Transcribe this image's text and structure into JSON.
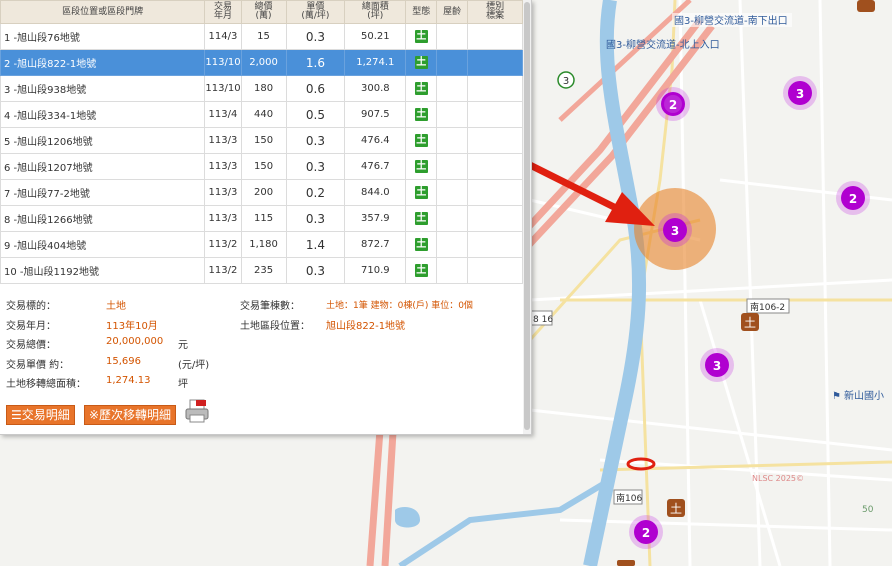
{
  "table": {
    "headers": {
      "address": "區段位置或區段門牌",
      "date": "交易\n年月",
      "total": "總價\n(萬)",
      "unit": "單價\n(萬/坪)",
      "area": "總面積\n(坪)",
      "type": "型態",
      "age": "屋齡",
      "special": "標別\n標案"
    },
    "rows": [
      {
        "address": "1 -旭山段76地號",
        "date": "114/3",
        "total": "15",
        "unit": "0.3",
        "area": "50.21",
        "type": "土"
      },
      {
        "address": "2 -旭山段822-1地號",
        "date": "113/10",
        "total": "2,000",
        "unit": "1.6",
        "area": "1,274.1",
        "type": "土"
      },
      {
        "address": "3 -旭山段938地號",
        "date": "113/10",
        "total": "180",
        "unit": "0.6",
        "area": "300.8",
        "type": "土"
      },
      {
        "address": "4 -旭山段334-1地號",
        "date": "113/4",
        "total": "440",
        "unit": "0.5",
        "area": "907.5",
        "type": "土"
      },
      {
        "address": "5 -旭山段1206地號",
        "date": "113/3",
        "total": "150",
        "unit": "0.3",
        "area": "476.4",
        "type": "土"
      },
      {
        "address": "6 -旭山段1207地號",
        "date": "113/3",
        "total": "150",
        "unit": "0.3",
        "area": "476.7",
        "type": "土"
      },
      {
        "address": "7 -旭山段77-2地號",
        "date": "113/3",
        "total": "200",
        "unit": "0.2",
        "area": "844.0",
        "type": "土"
      },
      {
        "address": "8 -旭山段1266地號",
        "date": "113/3",
        "total": "115",
        "unit": "0.3",
        "area": "357.9",
        "type": "土"
      },
      {
        "address": "9 -旭山段404地號",
        "date": "113/2",
        "total": "1,180",
        "unit": "1.4",
        "area": "872.7",
        "type": "土"
      },
      {
        "address": "10 -旭山段1192地號",
        "date": "113/2",
        "total": "235",
        "unit": "0.3",
        "area": "710.9",
        "type": "土"
      }
    ],
    "selected_index": 1
  },
  "details": {
    "target_label": "交易標的：",
    "target_value": "土地",
    "date_label": "交易年月：",
    "date_value": "113年10月",
    "total_label": "交易總價：",
    "total_value": "20,000,000",
    "total_unit": "元",
    "unit_label": "交易單價 約：",
    "unit_value": "15,696",
    "unit_unit": "(元/坪)",
    "area_label": "土地移轉總面積：",
    "area_value": "1,274.13",
    "area_unit": "坪",
    "count_label": "交易筆棟數：",
    "count_value": "土地：1筆 建物：0棟(戶) 車位：0個",
    "location_label": "土地區段位置：",
    "location_value": "旭山段822-1地號"
  },
  "buttons": {
    "detail": "交易明細",
    "history": "※歷次移轉明細"
  },
  "map": {
    "labels": {
      "interchange_south": "國3-柳營交流道-南下出口",
      "interchange_north": "國3-柳營交流道-北上入口",
      "route3": "3",
      "road_16": "8 16",
      "road_106_2": "南106-2",
      "road_106": "南106",
      "school": "新山國小",
      "watermark": "NLSC 2025©",
      "num_50": "50"
    },
    "clusters": [
      "2",
      "3",
      "2",
      "3",
      "3",
      "2"
    ],
    "land_marker": "土",
    "colors": {
      "cluster": "#b000d0",
      "highlight": "#e8842a",
      "arrow": "#e02010",
      "river": "#9ec9e8",
      "highway": "#f2a79a"
    }
  }
}
